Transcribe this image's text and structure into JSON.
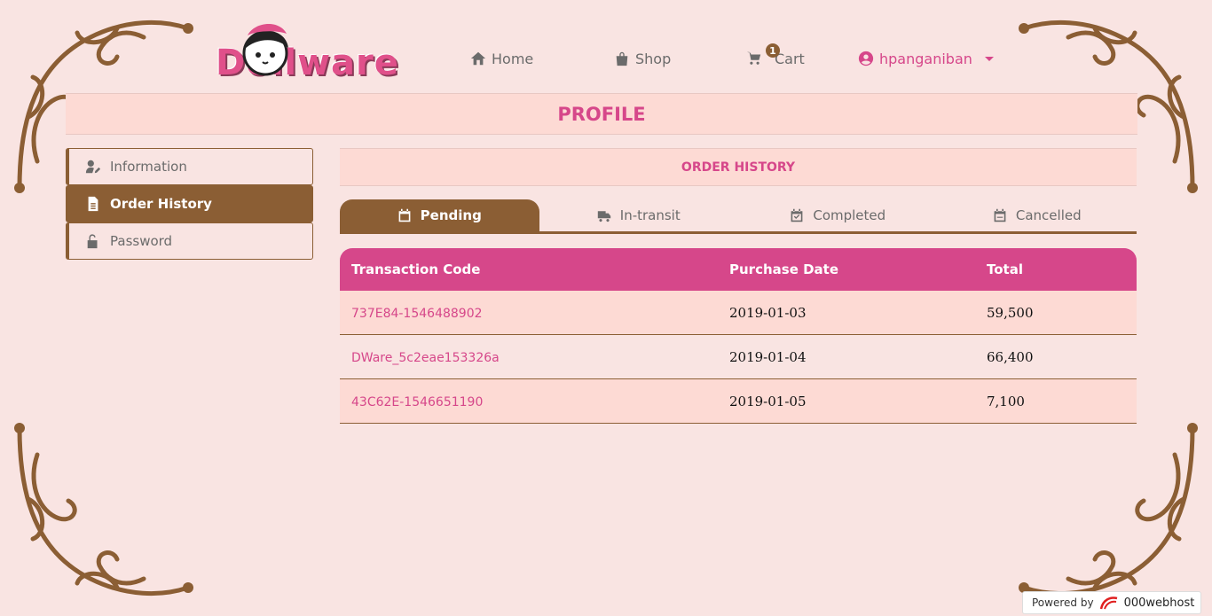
{
  "brand": {
    "logo_text": "Dollware"
  },
  "nav": {
    "home_label": "Home",
    "shop_label": "Shop",
    "cart_label": "Cart",
    "cart_count": "1",
    "user_label": "hpanganiban"
  },
  "profile": {
    "title": "PROFILE"
  },
  "sidebar": {
    "items": [
      {
        "label": "Information",
        "icon": "user-edit-icon"
      },
      {
        "label": "Order History",
        "icon": "file-icon"
      },
      {
        "label": "Password",
        "icon": "unlock-icon"
      }
    ]
  },
  "orders": {
    "title": "ORDER HISTORY",
    "tabs": [
      {
        "label": "Pending",
        "icon": "calendar-icon",
        "active": true
      },
      {
        "label": "In-transit",
        "icon": "truck-icon"
      },
      {
        "label": "Completed",
        "icon": "calendar-check-icon"
      },
      {
        "label": "Cancelled",
        "icon": "calendar-minus-icon"
      }
    ],
    "columns": [
      "Transaction Code",
      "Purchase Date",
      "Total"
    ],
    "rows": [
      {
        "code": "737E84-1546488902",
        "date": "2019-01-03",
        "total": "59,500"
      },
      {
        "code": "DWare_5c2eae153326a",
        "date": "2019-01-04",
        "total": "66,400"
      },
      {
        "code": "43C62E-1546651190",
        "date": "2019-01-05",
        "total": "7,100"
      }
    ]
  },
  "footer": {
    "powered_label": "Powered by",
    "host_label": "000webhost"
  },
  "colors": {
    "accent_pink": "#d6478a",
    "accent_brown": "#8b5e34",
    "background": "#f9e4e2",
    "banner": "#fddad4"
  }
}
